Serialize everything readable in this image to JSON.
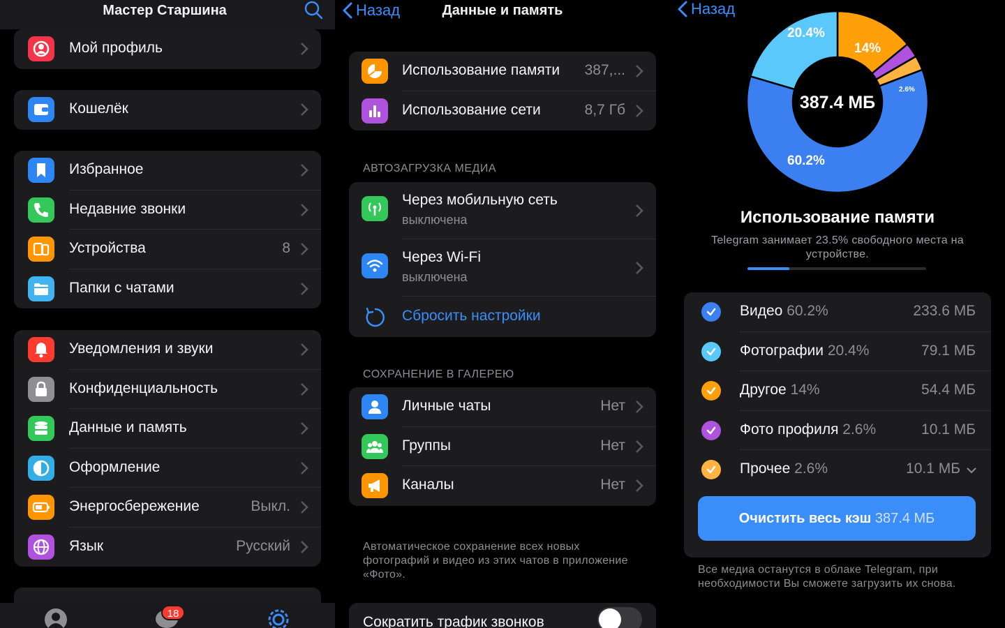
{
  "colors": {
    "accent": "#3b8dfa",
    "background": "#000000",
    "cell": "#1c1c1e",
    "secondary": "#8e8e93"
  },
  "settings": {
    "title": "Мастер Старшина",
    "groups": [
      [
        {
          "label": "Мой профиль",
          "icon": "profile-icon",
          "color": "#f2354a"
        }
      ],
      [
        {
          "label": "Кошелёк",
          "icon": "wallet-icon",
          "color": "#2e86f5"
        }
      ],
      [
        {
          "label": "Избранное",
          "icon": "bookmark-icon",
          "color": "#2e86f5"
        },
        {
          "label": "Недавние звонки",
          "icon": "phone-icon",
          "color": "#34c759"
        },
        {
          "label": "Устройства",
          "value": "8",
          "icon": "devices-icon",
          "color": "#ff9500"
        },
        {
          "label": "Папки с чатами",
          "icon": "folder-icon",
          "color": "#40b3f0"
        }
      ],
      [
        {
          "label": "Уведомления и звуки",
          "icon": "notification-icon",
          "color": "#ff3b30"
        },
        {
          "label": "Конфиденциальность",
          "icon": "lock-icon",
          "color": "#8e8e93"
        },
        {
          "label": "Данные и память",
          "icon": "database-icon",
          "color": "#34c759"
        },
        {
          "label": "Оформление",
          "icon": "appearance-icon",
          "color": "#32ade6"
        },
        {
          "label": "Энергосбережение",
          "value": "Выкл.",
          "icon": "battery-icon",
          "color": "#ff9500"
        },
        {
          "label": "Язык",
          "value": "Русский",
          "icon": "globe-icon",
          "color": "#af52de"
        }
      ]
    ],
    "tabbar": {
      "badge": "18"
    }
  },
  "data_memory": {
    "back": "Назад",
    "title": "Данные и память",
    "usage": [
      {
        "label": "Использование памяти",
        "value": "387,...",
        "icon": "pie-icon",
        "color": "#ff9500"
      },
      {
        "label": "Использование сети",
        "value": "8,7 Гб",
        "icon": "bar-chart-icon",
        "color": "#af52de"
      }
    ],
    "autoload_header": "АВТОЗАГРУЗКА МЕДИА",
    "autoload": [
      {
        "label": "Через мобильную сеть",
        "sub": "выключена",
        "icon": "cellular-icon",
        "color": "#34c759"
      },
      {
        "label": "Через Wi-Fi",
        "sub": "выключена",
        "icon": "wifi-icon",
        "color": "#2e86f5"
      }
    ],
    "reset": "Сбросить настройки",
    "gallery_header": "СОХРАНЕНИЕ В ГАЛЕРЕЮ",
    "gallery": [
      {
        "label": "Личные чаты",
        "value": "Нет",
        "icon": "person-icon",
        "color": "#2e86f5"
      },
      {
        "label": "Группы",
        "value": "Нет",
        "icon": "group-icon",
        "color": "#34c759"
      },
      {
        "label": "Каналы",
        "value": "Нет",
        "icon": "megaphone-icon",
        "color": "#ff9500"
      }
    ],
    "gallery_footnote": [
      "Автоматическое сохранение всех новых",
      "фотографий и видео из этих чатов в приложение",
      "«Фото»."
    ],
    "reduce_calls": "Сократить трафик звонков",
    "reduce_calls_on": false
  },
  "storage": {
    "back": "Назад",
    "total": "387.4 МБ",
    "title": "Использование памяти",
    "subtitle": "Telegram занимает 23.5% свободного места на устройстве.",
    "used_fraction": 0.235,
    "categories": [
      {
        "name": "Видео",
        "pct": "60.2%",
        "size": "233.6 МБ",
        "percent": 60.2,
        "color": "#3b7ff0"
      },
      {
        "name": "Фотографии",
        "pct": "20.4%",
        "size": "79.1 МБ",
        "percent": 20.4,
        "color": "#5ac8fa"
      },
      {
        "name": "Другое",
        "pct": "14%",
        "size": "54.4 МБ",
        "percent": 14,
        "color": "#ff9f0a"
      },
      {
        "name": "Фото профиля",
        "pct": "2.6%",
        "size": "10.1 МБ",
        "percent": 2.6,
        "color": "#af52de"
      },
      {
        "name": "Прочее",
        "pct": "2.6%",
        "size": "10.1 МБ",
        "percent": 2.6,
        "color": "#ffb340",
        "expandable": true
      }
    ],
    "donut_labels": [
      "20.4%",
      "14%",
      "2.6%",
      "60.2%"
    ],
    "clear_label": "Очистить весь кэш",
    "clear_size": "387.4 МБ",
    "footnote": [
      "Все медиа останутся в облаке Telegram, при",
      "необходимости Вы сможете загрузить их снова."
    ]
  }
}
